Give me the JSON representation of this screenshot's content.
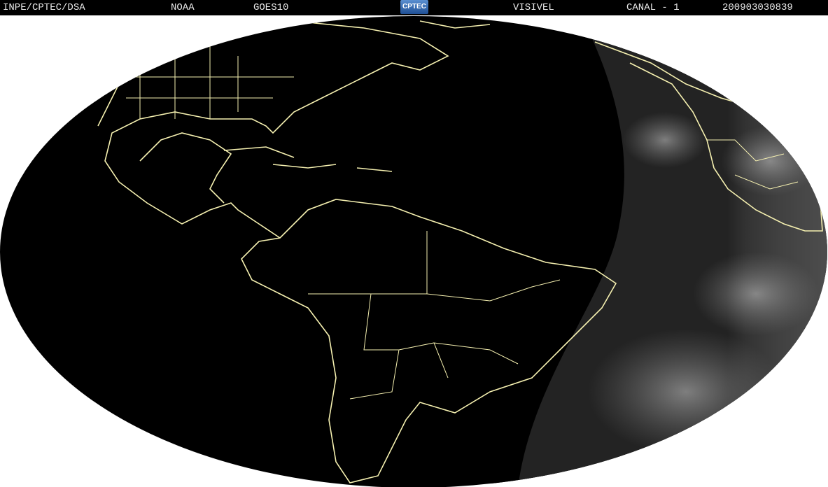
{
  "header": {
    "institution": "INPE/CPTEC/DSA",
    "agency": "NOAA",
    "satellite": "GOES10",
    "logo_text": "CPTEC",
    "band": "VISIVEL",
    "channel": "CANAL - 1",
    "timestamp": "200903030839"
  },
  "colors": {
    "boundaries": "#f5f0b0",
    "background": "#000000",
    "daylight": "#6e6e6e"
  }
}
